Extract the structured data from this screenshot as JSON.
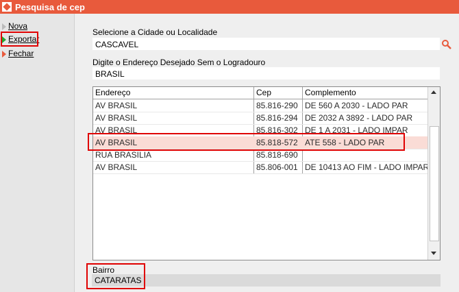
{
  "window": {
    "title": "Pesquisa de cep"
  },
  "sidebar": {
    "items": [
      {
        "id": "nova",
        "label": "Nova"
      },
      {
        "id": "exportar",
        "label": "Exportar"
      },
      {
        "id": "fechar",
        "label": "Fechar"
      }
    ]
  },
  "form": {
    "cidade_label": "Selecione a Cidade ou Localidade",
    "cidade_value": "CASCAVEL",
    "endereco_label": "Digite o Endereço Desejado Sem o Logradouro",
    "endereco_value": "BRASIL"
  },
  "grid": {
    "columns": [
      "Endereço",
      "Cep",
      "Complemento"
    ],
    "rows": [
      [
        "AV BRASIL",
        "85.816-290",
        "DE 560 A 2030 - LADO PAR"
      ],
      [
        "AV BRASIL",
        "85.816-294",
        "DE 2032 A 3892 - LADO PAR"
      ],
      [
        "AV BRASIL",
        "85.816-302",
        "DE 1 A 2031 - LADO IMPAR"
      ],
      [
        "AV BRASIL",
        "85.818-572",
        "ATE 558 - LADO PAR"
      ],
      [
        "RUA BRASILIA",
        "85.818-690",
        ""
      ],
      [
        "AV BRASIL",
        "85.806-001",
        "DE 10413 AO FIM - LADO IMPAR"
      ]
    ],
    "selected_row": 3
  },
  "bairro": {
    "label": "Bairro",
    "value": "CATARATAS"
  },
  "colors": {
    "title_bar": "#e85a3c",
    "selected_row": "#fadcd6",
    "highlight": "#e00000"
  },
  "icons": {
    "app": "app-logo-icon",
    "search": "search-icon"
  }
}
